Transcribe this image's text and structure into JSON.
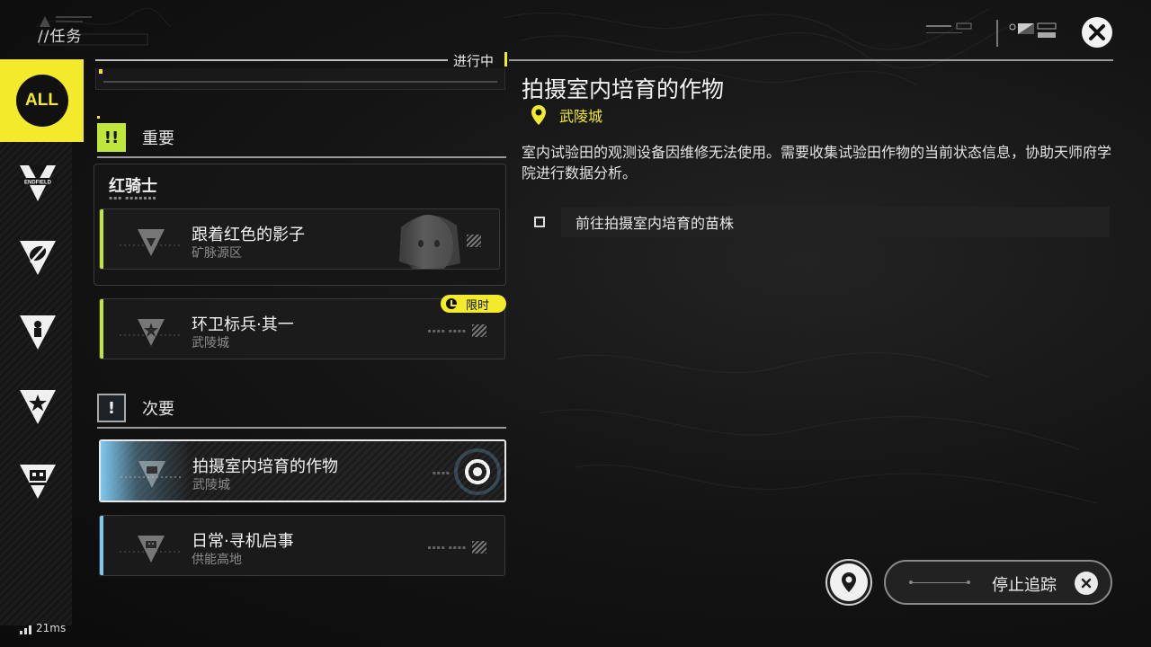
{
  "header": {
    "breadcrumb": "//任务",
    "status_tab": "进行中"
  },
  "categories": [
    {
      "label": "ALL",
      "icon": "all-icon",
      "selected": true
    },
    {
      "icon": "endfield-icon",
      "brand_text": "ENDFIELD"
    },
    {
      "icon": "leaf-icon"
    },
    {
      "icon": "keyhole-icon"
    },
    {
      "icon": "star-icon"
    },
    {
      "icon": "building-icon"
    }
  ],
  "sections": {
    "major": {
      "badge": "!!",
      "label": "重要"
    },
    "minor": {
      "badge": "!",
      "label": "次要"
    }
  },
  "quest_group": {
    "title": "红骑士"
  },
  "quests": [
    {
      "name": "跟着红色的影子",
      "location": "矿脉源区"
    },
    {
      "name": "环卫标兵·其一",
      "location": "武陵城",
      "badge": "限时"
    },
    {
      "name": "拍摄室内培育的作物",
      "location": "武陵城",
      "selected": true,
      "tracked": true
    },
    {
      "name": "日常·寻机启事",
      "location": "供能高地"
    }
  ],
  "detail": {
    "title": "拍摄室内培育的作物",
    "location": "武陵城",
    "description": "室内试验田的观测设备因维修无法使用。需要收集试验田作物的当前状态信息，协助天师府学院进行数据分析。",
    "objectives": [
      "前往拍摄室内培育的苗株"
    ]
  },
  "actions": {
    "stop_tracking": "停止追踪"
  },
  "network": {
    "latency": "21ms"
  },
  "colors": {
    "accent_yellow": "#f2ea2a",
    "major_green": "#bfe63a",
    "minor_blue": "#7ec8ef"
  }
}
